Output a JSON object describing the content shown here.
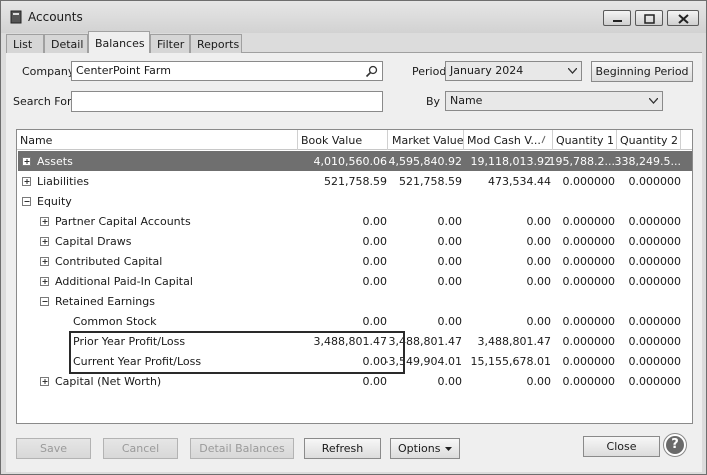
{
  "window": {
    "title": "Accounts"
  },
  "tabs": [
    {
      "label": "List"
    },
    {
      "label": "Detail"
    },
    {
      "label": "Balances"
    },
    {
      "label": "Filter"
    },
    {
      "label": "Reports"
    }
  ],
  "form": {
    "company_label": "Company",
    "company_value": "CenterPoint Farm",
    "search_label": "Search For",
    "search_value": "",
    "period_label": "Period",
    "period_value": "January 2024",
    "beginning_period_label": "Beginning Period",
    "by_label": "By",
    "by_value": "Name"
  },
  "grid": {
    "columns": [
      "Name",
      "Book Value",
      "Market Value",
      "Mod Cash V...",
      "Quantity 1",
      "Quantity 2"
    ],
    "rows": [
      {
        "name": "Assets",
        "book": "4,010,560.06",
        "market": "4,595,840.92",
        "mod": "19,118,013.92",
        "q1": "195,788.2...",
        "q2": "338,249.5..."
      },
      {
        "name": "Liabilities",
        "book": "521,758.59",
        "market": "521,758.59",
        "mod": "473,534.44",
        "q1": "0.000000",
        "q2": "0.000000"
      },
      {
        "name": "Equity",
        "book": "",
        "market": "",
        "mod": "",
        "q1": "",
        "q2": ""
      },
      {
        "name": "Partner Capital Accounts",
        "book": "0.00",
        "market": "0.00",
        "mod": "0.00",
        "q1": "0.000000",
        "q2": "0.000000"
      },
      {
        "name": "Capital Draws",
        "book": "0.00",
        "market": "0.00",
        "mod": "0.00",
        "q1": "0.000000",
        "q2": "0.000000"
      },
      {
        "name": "Contributed Capital",
        "book": "0.00",
        "market": "0.00",
        "mod": "0.00",
        "q1": "0.000000",
        "q2": "0.000000"
      },
      {
        "name": "Additional Paid-In Capital",
        "book": "0.00",
        "market": "0.00",
        "mod": "0.00",
        "q1": "0.000000",
        "q2": "0.000000"
      },
      {
        "name": "Retained Earnings",
        "book": "",
        "market": "",
        "mod": "",
        "q1": "",
        "q2": ""
      },
      {
        "name": "Common Stock",
        "book": "0.00",
        "market": "0.00",
        "mod": "0.00",
        "q1": "0.000000",
        "q2": "0.000000"
      },
      {
        "name": "Prior Year Profit/Loss",
        "book": "3,488,801.47",
        "market": "3,488,801.47",
        "mod": "3,488,801.47",
        "q1": "0.000000",
        "q2": "0.000000"
      },
      {
        "name": "Current Year Profit/Loss",
        "book": "0.00",
        "market": "-3,549,904.01",
        "mod": "15,155,678.01",
        "q1": "0.000000",
        "q2": "0.000000"
      },
      {
        "name": "Capital (Net Worth)",
        "book": "0.00",
        "market": "0.00",
        "mod": "0.00",
        "q1": "0.000000",
        "q2": "0.000000"
      }
    ]
  },
  "buttons": {
    "save": "Save",
    "cancel": "Cancel",
    "detail_balances": "Detail Balances",
    "refresh": "Refresh",
    "options": "Options",
    "close": "Close"
  },
  "help": {
    "glyph": "?"
  }
}
